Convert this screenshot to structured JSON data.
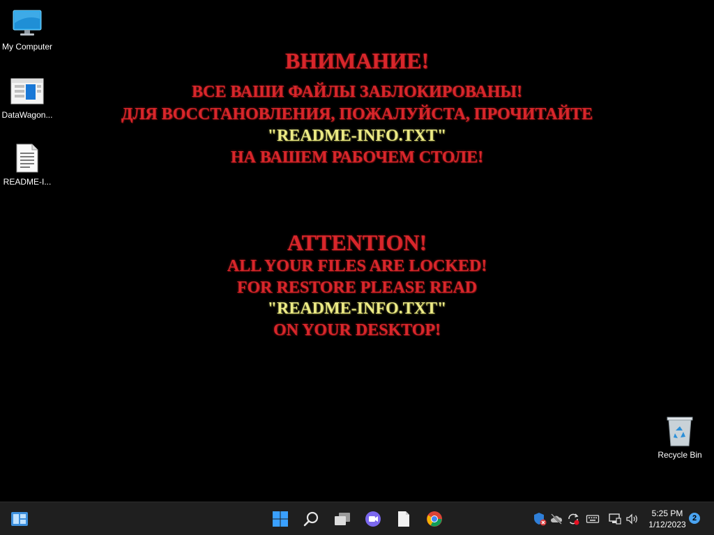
{
  "desktop": {
    "icons": [
      {
        "label": "My Computer",
        "icon": "monitor-icon"
      },
      {
        "label": "DataWagon...",
        "icon": "app-window-icon"
      },
      {
        "label": "README-I...",
        "icon": "text-file-icon"
      },
      {
        "label": "Recycle Bin",
        "icon": "recycle-bin-icon"
      }
    ]
  },
  "ransom_note": {
    "ru": {
      "heading": "ВНИМАНИЕ!",
      "line1": "ВСЕ ВАШИ ФАЙЛЫ ЗАБЛОКИРОВАНЫ!",
      "line2": "ДЛЯ ВОССТАНОВЛЕНИЯ, ПОЖАЛУЙСТА, ПРОЧИТАЙТЕ",
      "file": "\"README-INFO.TXT\"",
      "line3": "НА ВАШЕМ РАБОЧЕМ СТОЛЕ!"
    },
    "en": {
      "heading": "ATTENTION!",
      "line1": "ALL YOUR FILES ARE LOCKED!",
      "line2": "FOR RESTORE PLEASE READ",
      "file": "\"README-INFO.TXT\"",
      "line3": "ON YOUR DESKTOP!"
    },
    "colors": {
      "red": "#d8262b",
      "yellow": "#ecea86"
    }
  },
  "taskbar": {
    "widgets_icon": "widgets-icon",
    "pinned": [
      "start-icon",
      "search-icon",
      "task-view-icon",
      "chat-icon",
      "file-icon",
      "chrome-icon"
    ],
    "tray": [
      "security-icon",
      "cloud-offline-icon",
      "sync-icon",
      "keyboard-icon",
      "network-icon",
      "volume-icon"
    ],
    "clock": {
      "time": "5:25 PM",
      "date": "1/12/2023"
    },
    "notification_count": "2"
  }
}
